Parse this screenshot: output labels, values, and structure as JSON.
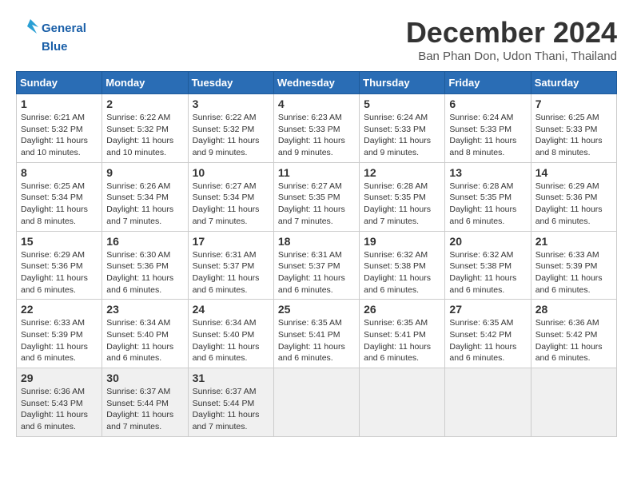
{
  "logo": {
    "line1": "General",
    "line2": "Blue"
  },
  "title": "December 2024",
  "subtitle": "Ban Phan Don, Udon Thani, Thailand",
  "days_header": [
    "Sunday",
    "Monday",
    "Tuesday",
    "Wednesday",
    "Thursday",
    "Friday",
    "Saturday"
  ],
  "weeks": [
    [
      {
        "day": "1",
        "info": "Sunrise: 6:21 AM\nSunset: 5:32 PM\nDaylight: 11 hours\nand 10 minutes."
      },
      {
        "day": "2",
        "info": "Sunrise: 6:22 AM\nSunset: 5:32 PM\nDaylight: 11 hours\nand 10 minutes."
      },
      {
        "day": "3",
        "info": "Sunrise: 6:22 AM\nSunset: 5:32 PM\nDaylight: 11 hours\nand 9 minutes."
      },
      {
        "day": "4",
        "info": "Sunrise: 6:23 AM\nSunset: 5:33 PM\nDaylight: 11 hours\nand 9 minutes."
      },
      {
        "day": "5",
        "info": "Sunrise: 6:24 AM\nSunset: 5:33 PM\nDaylight: 11 hours\nand 9 minutes."
      },
      {
        "day": "6",
        "info": "Sunrise: 6:24 AM\nSunset: 5:33 PM\nDaylight: 11 hours\nand 8 minutes."
      },
      {
        "day": "7",
        "info": "Sunrise: 6:25 AM\nSunset: 5:33 PM\nDaylight: 11 hours\nand 8 minutes."
      }
    ],
    [
      {
        "day": "8",
        "info": "Sunrise: 6:25 AM\nSunset: 5:34 PM\nDaylight: 11 hours\nand 8 minutes."
      },
      {
        "day": "9",
        "info": "Sunrise: 6:26 AM\nSunset: 5:34 PM\nDaylight: 11 hours\nand 7 minutes."
      },
      {
        "day": "10",
        "info": "Sunrise: 6:27 AM\nSunset: 5:34 PM\nDaylight: 11 hours\nand 7 minutes."
      },
      {
        "day": "11",
        "info": "Sunrise: 6:27 AM\nSunset: 5:35 PM\nDaylight: 11 hours\nand 7 minutes."
      },
      {
        "day": "12",
        "info": "Sunrise: 6:28 AM\nSunset: 5:35 PM\nDaylight: 11 hours\nand 7 minutes."
      },
      {
        "day": "13",
        "info": "Sunrise: 6:28 AM\nSunset: 5:35 PM\nDaylight: 11 hours\nand 6 minutes."
      },
      {
        "day": "14",
        "info": "Sunrise: 6:29 AM\nSunset: 5:36 PM\nDaylight: 11 hours\nand 6 minutes."
      }
    ],
    [
      {
        "day": "15",
        "info": "Sunrise: 6:29 AM\nSunset: 5:36 PM\nDaylight: 11 hours\nand 6 minutes."
      },
      {
        "day": "16",
        "info": "Sunrise: 6:30 AM\nSunset: 5:36 PM\nDaylight: 11 hours\nand 6 minutes."
      },
      {
        "day": "17",
        "info": "Sunrise: 6:31 AM\nSunset: 5:37 PM\nDaylight: 11 hours\nand 6 minutes."
      },
      {
        "day": "18",
        "info": "Sunrise: 6:31 AM\nSunset: 5:37 PM\nDaylight: 11 hours\nand 6 minutes."
      },
      {
        "day": "19",
        "info": "Sunrise: 6:32 AM\nSunset: 5:38 PM\nDaylight: 11 hours\nand 6 minutes."
      },
      {
        "day": "20",
        "info": "Sunrise: 6:32 AM\nSunset: 5:38 PM\nDaylight: 11 hours\nand 6 minutes."
      },
      {
        "day": "21",
        "info": "Sunrise: 6:33 AM\nSunset: 5:39 PM\nDaylight: 11 hours\nand 6 minutes."
      }
    ],
    [
      {
        "day": "22",
        "info": "Sunrise: 6:33 AM\nSunset: 5:39 PM\nDaylight: 11 hours\nand 6 minutes."
      },
      {
        "day": "23",
        "info": "Sunrise: 6:34 AM\nSunset: 5:40 PM\nDaylight: 11 hours\nand 6 minutes."
      },
      {
        "day": "24",
        "info": "Sunrise: 6:34 AM\nSunset: 5:40 PM\nDaylight: 11 hours\nand 6 minutes."
      },
      {
        "day": "25",
        "info": "Sunrise: 6:35 AM\nSunset: 5:41 PM\nDaylight: 11 hours\nand 6 minutes."
      },
      {
        "day": "26",
        "info": "Sunrise: 6:35 AM\nSunset: 5:41 PM\nDaylight: 11 hours\nand 6 minutes."
      },
      {
        "day": "27",
        "info": "Sunrise: 6:35 AM\nSunset: 5:42 PM\nDaylight: 11 hours\nand 6 minutes."
      },
      {
        "day": "28",
        "info": "Sunrise: 6:36 AM\nSunset: 5:42 PM\nDaylight: 11 hours\nand 6 minutes."
      }
    ],
    [
      {
        "day": "29",
        "info": "Sunrise: 6:36 AM\nSunset: 5:43 PM\nDaylight: 11 hours\nand 6 minutes."
      },
      {
        "day": "30",
        "info": "Sunrise: 6:37 AM\nSunset: 5:44 PM\nDaylight: 11 hours\nand 7 minutes."
      },
      {
        "day": "31",
        "info": "Sunrise: 6:37 AM\nSunset: 5:44 PM\nDaylight: 11 hours\nand 7 minutes."
      },
      {
        "day": "",
        "info": ""
      },
      {
        "day": "",
        "info": ""
      },
      {
        "day": "",
        "info": ""
      },
      {
        "day": "",
        "info": ""
      }
    ]
  ]
}
